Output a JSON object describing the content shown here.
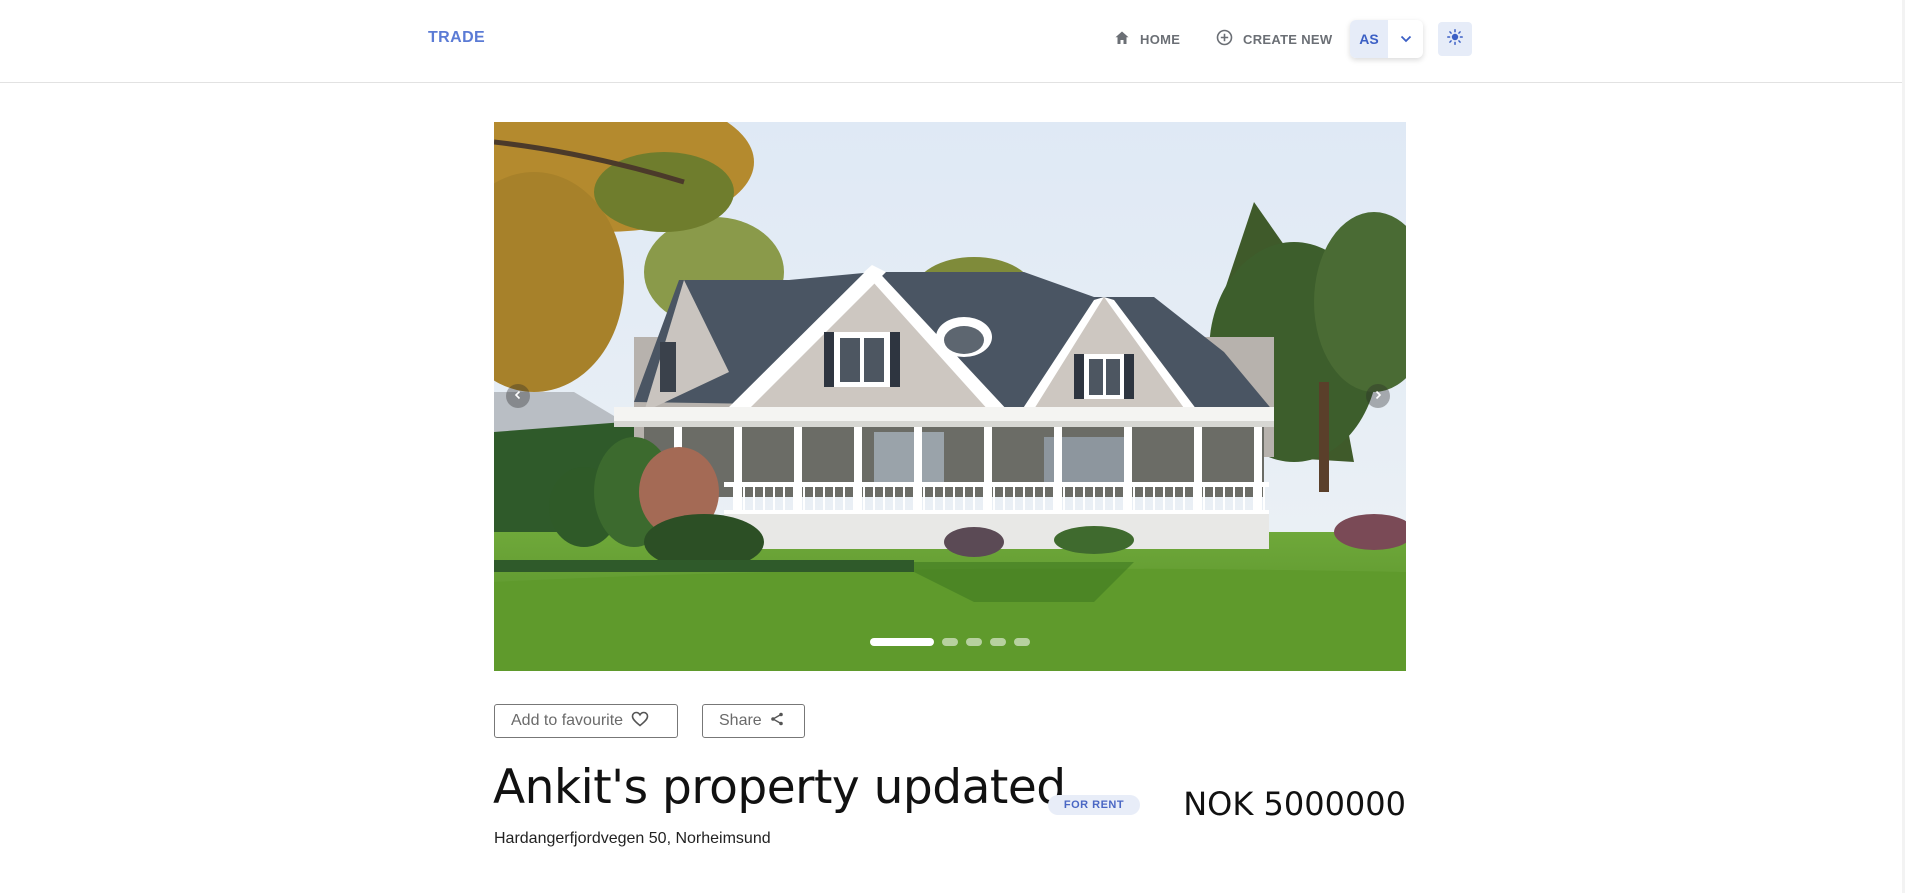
{
  "header": {
    "brand": "TRADE",
    "nav": {
      "home_label": "HOME",
      "create_label": "CREATE NEW"
    },
    "user": {
      "initials": "AS"
    },
    "theme_toggle_icon": "sun-icon"
  },
  "colors": {
    "accent": "#5b7bd5",
    "accent_dark": "#3b5fc5",
    "chip_bg": "#e6ecf8"
  },
  "carousel": {
    "slide_count": 5,
    "active_index": 0,
    "prev_icon": "chevron-left-icon",
    "next_icon": "chevron-right-icon"
  },
  "actions": {
    "favourite_label": "Add to favourite",
    "favourite_icon": "heart-icon",
    "share_label": "Share",
    "share_icon": "share-icon"
  },
  "listing": {
    "title": "Ankit's property updated",
    "badge": "FOR RENT",
    "price": "NOK 5000000",
    "address": "Hardangerfjordvegen 50, Norheimsund"
  }
}
